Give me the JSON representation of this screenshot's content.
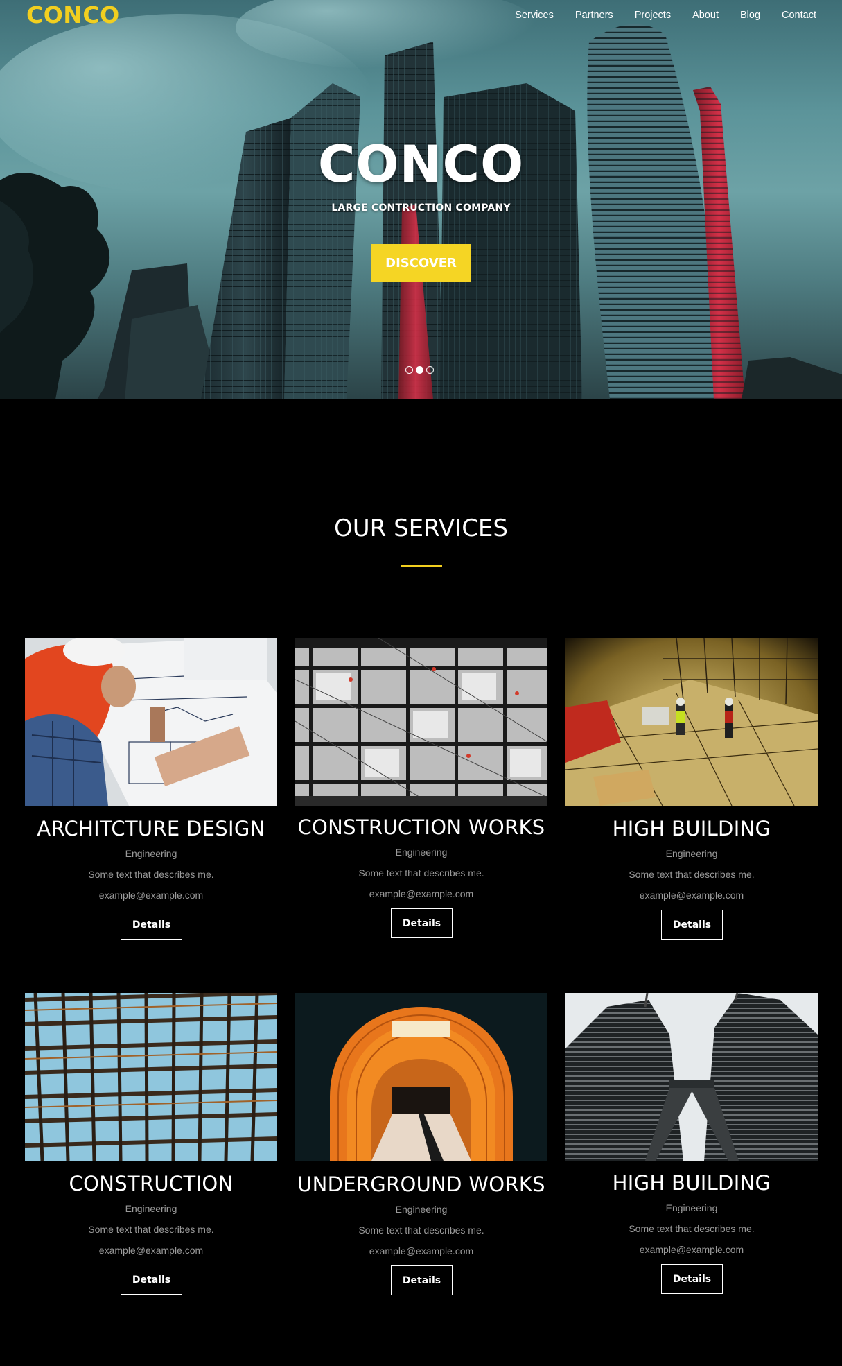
{
  "nav": {
    "logo": "CONCO",
    "items": [
      "Services",
      "Partners",
      "Projects",
      "About",
      "Blog",
      "Contact"
    ]
  },
  "hero": {
    "title": "CONCO",
    "subtitle": "LARGE CONTRUCTION COMPANY",
    "cta_label": "DISCOVER",
    "slides_total": 3,
    "slide_active": 2
  },
  "services": {
    "title": "OUR SERVICES",
    "accent_color": "#f2cf1f",
    "cards": [
      {
        "title": "ARCHITCTURE DESIGN",
        "category": "Engineering",
        "description": "Some text that describes me.",
        "email": "example@example.com",
        "button": "Details"
      },
      {
        "title": "CONSTRUCTION WORKS",
        "category": "Engineering",
        "description": "Some text that describes me.",
        "email": "example@example.com",
        "button": "Details"
      },
      {
        "title": "HIGH BUILDING",
        "category": "Engineering",
        "description": "Some text that describes me.",
        "email": "example@example.com",
        "button": "Details"
      },
      {
        "title": "CONSTRUCTION",
        "category": "Engineering",
        "description": "Some text that describes me.",
        "email": "example@example.com",
        "button": "Details"
      },
      {
        "title": "UNDERGROUND WORKS",
        "category": "Engineering",
        "description": "Some text that describes me.",
        "email": "example@example.com",
        "button": "Details"
      },
      {
        "title": "HIGH BUILDING",
        "category": "Engineering",
        "description": "Some text that describes me.",
        "email": "example@example.com",
        "button": "Details"
      }
    ]
  }
}
